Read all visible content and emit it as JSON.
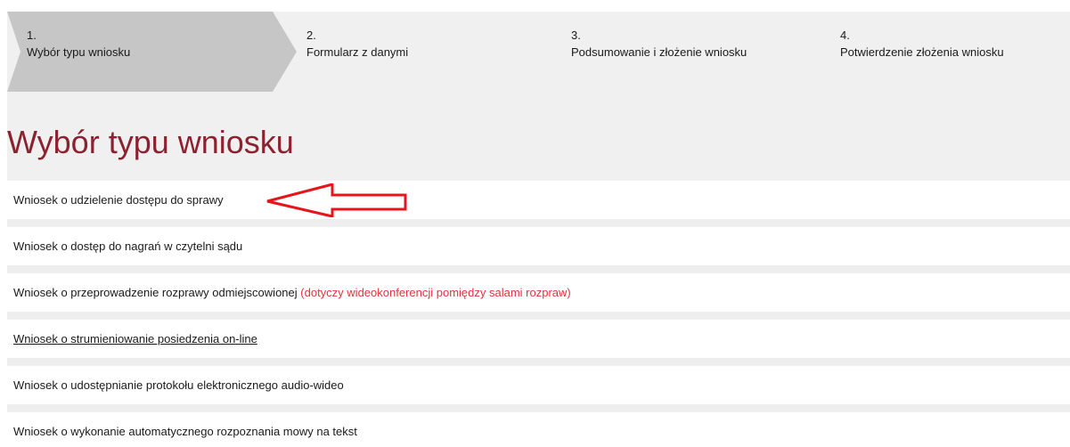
{
  "stepper": {
    "steps": [
      {
        "number": "1.",
        "label": "Wybór typu wniosku",
        "active": true
      },
      {
        "number": "2.",
        "label": "Formularz z danymi",
        "active": false
      },
      {
        "number": "3.",
        "label": "Podsumowanie i złożenie wniosku",
        "active": false
      },
      {
        "number": "4.",
        "label": "Potwierdzenie złożenia wniosku",
        "active": false
      }
    ]
  },
  "page_title": "Wybór typu wniosku",
  "options": [
    {
      "label": "Wniosek o udzielenie dostępu do sprawy",
      "note": ""
    },
    {
      "label": "Wniosek o dostęp do nagrań w czytelni sądu",
      "note": ""
    },
    {
      "label": "Wniosek o przeprowadzenie rozprawy odmiejscowionej",
      "note": "(dotyczy wideokonferencji pomiędzy salami rozpraw)"
    },
    {
      "label": "Wniosek o strumieniowanie posiedzenia on-line",
      "note": ""
    },
    {
      "label": "Wniosek o udostępnianie protokołu elektronicznego audio-wideo",
      "note": ""
    },
    {
      "label": "Wniosek o wykonanie automatycznego rozpoznania mowy na tekst",
      "note": ""
    }
  ],
  "colors": {
    "title": "#8c2130",
    "note": "#e0353d",
    "active_step": "#c6c6c6",
    "band": "#f0f0f0",
    "annotation_arrow": "#e8141b"
  },
  "annotation": {
    "icon": "left-arrow-outline-icon"
  }
}
